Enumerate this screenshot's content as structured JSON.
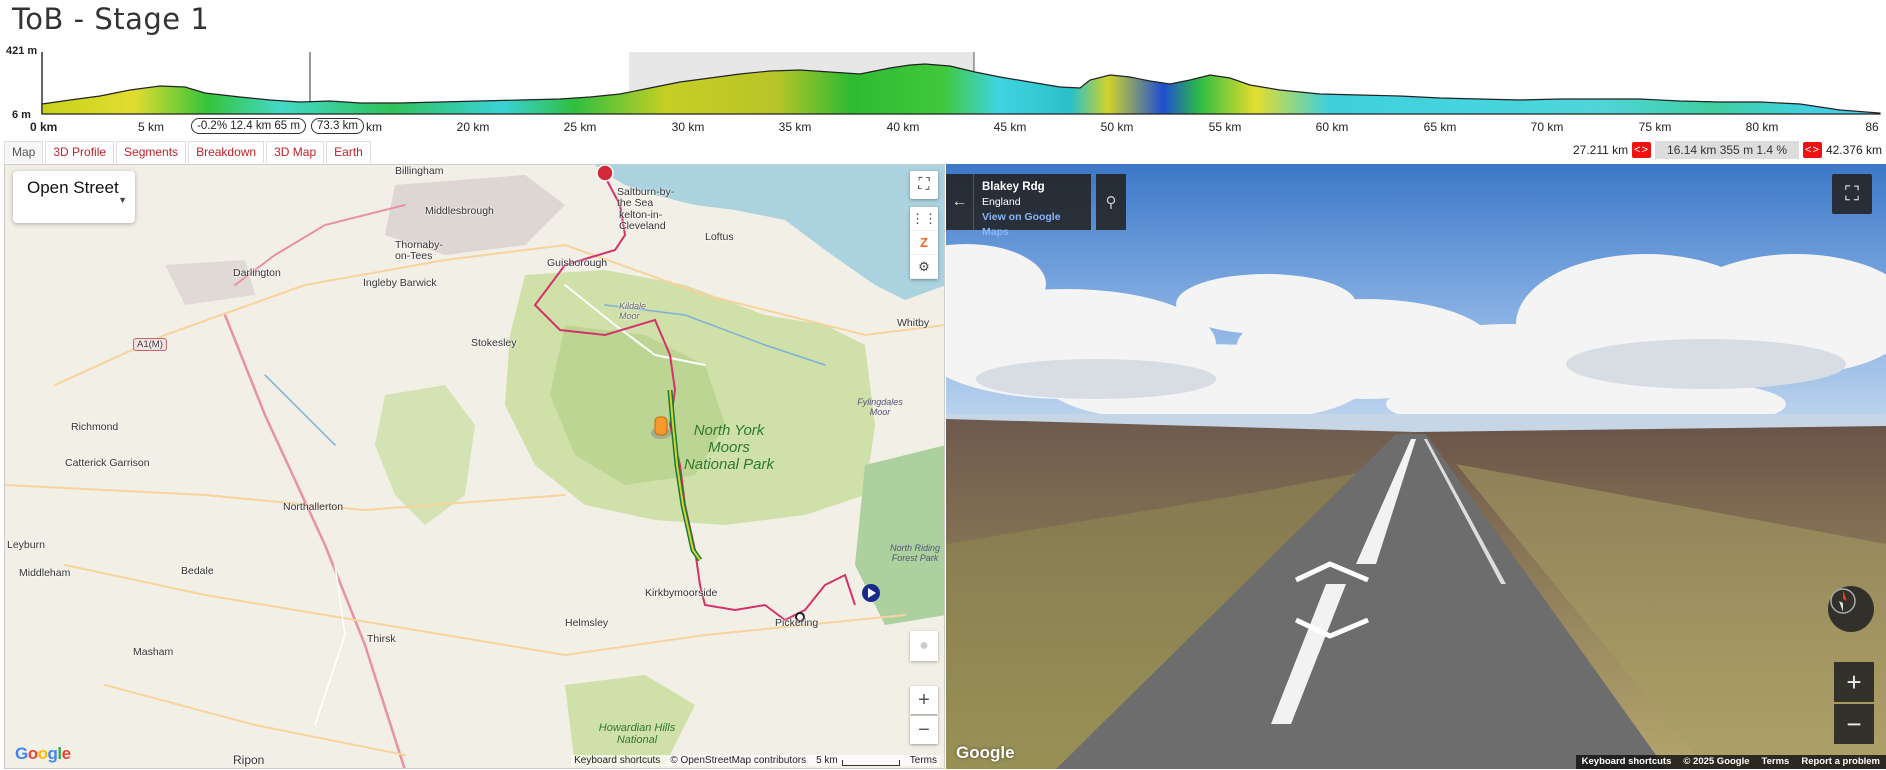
{
  "title": "ToB - Stage 1",
  "profile": {
    "y_max_label": "421 m",
    "y_min_label": "6 m",
    "x_ticks": [
      "0 km",
      "5 km",
      "10 km",
      "15 km",
      "20 km",
      "25 km",
      "30 km",
      "35 km",
      "40 km",
      "45 km",
      "50 km",
      "55 km",
      "60 km",
      "65 km",
      "70 km",
      "75 km",
      "80 km",
      "86"
    ],
    "selection_stats": "-0.2% 12.4 km 65 m",
    "cursor_label": "73.3 km"
  },
  "tabs": [
    {
      "label": "Map"
    },
    {
      "label": "3D Profile"
    },
    {
      "label": "Segments"
    },
    {
      "label": "Breakdown"
    },
    {
      "label": "3D Map"
    },
    {
      "label": "Earth"
    }
  ],
  "range": {
    "start": "27.211 km",
    "stats": "16.14 km 355 m 1.4 %",
    "end": "42.376 km",
    "arrow_label": "<>"
  },
  "map": {
    "layer": "Open Street",
    "places": [
      {
        "name": "Billingham"
      },
      {
        "name": "Middlesbrough"
      },
      {
        "name": "Saltburn-by-the Sea"
      },
      {
        "name": "kelton-in-Cleveland"
      },
      {
        "name": "Loftus"
      },
      {
        "name": "Thornaby-on-Tees"
      },
      {
        "name": "Darlington"
      },
      {
        "name": "Ingleby Barwick"
      },
      {
        "name": "Guisborough"
      },
      {
        "name": "Kildale Moor"
      },
      {
        "name": "Whitby"
      },
      {
        "name": "A1(M)"
      },
      {
        "name": "Stokesley"
      },
      {
        "name": "Richmond"
      },
      {
        "name": "Catterick Garrison"
      },
      {
        "name": "Northallerton"
      },
      {
        "name": "Leyburn"
      },
      {
        "name": "Bedale"
      },
      {
        "name": "Middleham"
      },
      {
        "name": "Thirsk"
      },
      {
        "name": "Masham"
      },
      {
        "name": "Kirkbymoorside"
      },
      {
        "name": "Helmsley"
      },
      {
        "name": "Pickering"
      },
      {
        "name": "Ripon"
      }
    ],
    "park": "North York Moors National Park",
    "howardian": "Howardian Hills National",
    "fylingdales": "Fylingdales Moor",
    "forest": "North Riding Forest Park",
    "google": "Google",
    "attribution": {
      "shortcuts": "Keyboard shortcuts",
      "osm": "© OpenStreetMap contributors",
      "scale": "5 km",
      "terms": "Terms"
    }
  },
  "streetview": {
    "road": "Blakey Rdg",
    "region": "England",
    "link": "View on Google Maps",
    "google": "Google",
    "attribution": {
      "shortcuts": "Keyboard shortcuts",
      "copyright": "© 2025 Google",
      "terms": "Terms",
      "report": "Report a problem"
    }
  }
}
